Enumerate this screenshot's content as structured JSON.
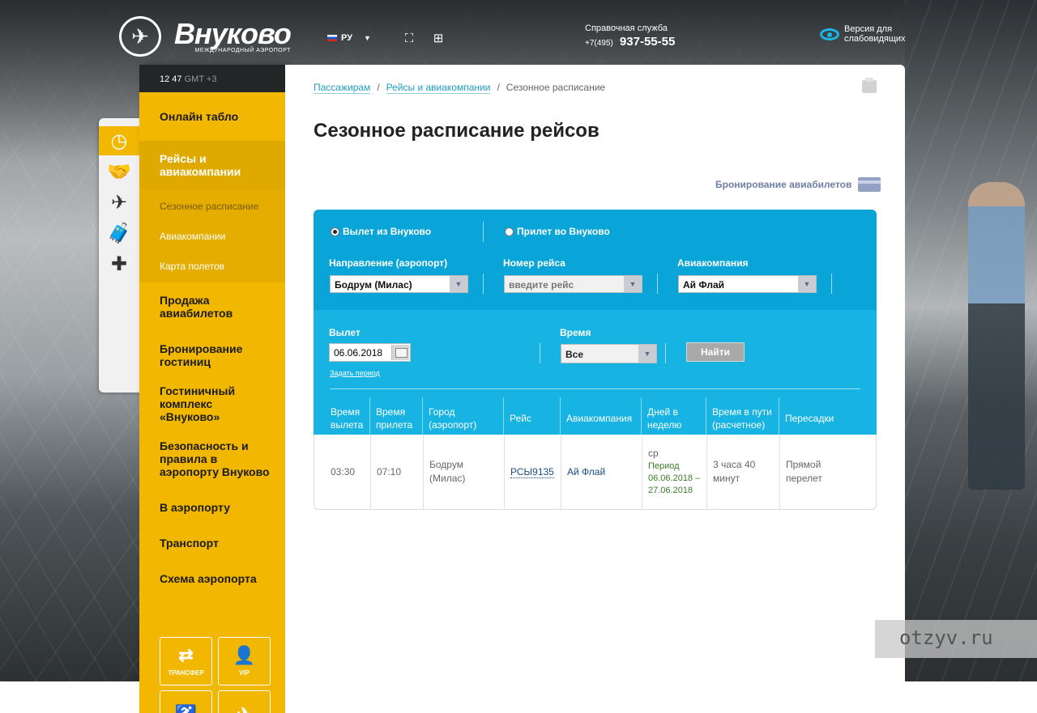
{
  "header": {
    "logo_name": "Внуково",
    "logo_sub": "МЕЖДУНАРОДНЫЙ АЭРОПОРТ",
    "lang": "РУ",
    "help_label": "Справочная служба",
    "phone_code": "+7(495)",
    "phone_number": "937-55-55",
    "accessibility_line1": "Версия для",
    "accessibility_line2": "слабовидящих"
  },
  "clock": {
    "time": "12 47",
    "tz": "GMT +3"
  },
  "sidebar": {
    "items": [
      {
        "label": "Онлайн табло"
      },
      {
        "label": "Рейсы и авиакомпании"
      },
      {
        "label": "Продажа авиабилетов"
      },
      {
        "label": "Бронирование гостиниц"
      },
      {
        "label": "Гостиничный комплекс «Внуково»"
      },
      {
        "label": "Безопасность и правила в аэропорту Внуково"
      },
      {
        "label": "В аэропорту"
      },
      {
        "label": "Транспорт"
      },
      {
        "label": "Схема аэропорта"
      }
    ],
    "subitems": [
      {
        "label": "Сезонное расписание"
      },
      {
        "label": "Авиакомпании"
      },
      {
        "label": "Карта полетов"
      }
    ],
    "tiles": [
      {
        "label": "ТРАНСФЕР"
      },
      {
        "label": "VIP"
      }
    ]
  },
  "breadcrumbs": [
    "Пассажирам",
    "Рейсы и авиакомпании",
    "Сезонное расписание"
  ],
  "page_title": "Сезонное расписание рейсов",
  "booking_link": "Бронирование авиабилетов",
  "search": {
    "radio_departure": "Вылет из Внуково",
    "radio_arrival": "Прилет во Внуково",
    "direction_label": "Направление (аэропорт)",
    "direction_value": "Бодрум (Милас)",
    "flight_label": "Номер рейса",
    "flight_placeholder": "введите рейс",
    "airline_label": "Авиакомпания",
    "airline_value": "Ай Флай",
    "date_label": "Вылет",
    "date_value": "06.06.2018",
    "period_link": "Задать период",
    "time_label": "Время",
    "time_value": "Все",
    "find_button": "Найти"
  },
  "table": {
    "headers": {
      "dep_time": "Время вылета",
      "arr_time": "Время прилета",
      "city": "Город (аэропорт)",
      "flight": "Рейс",
      "airline": "Авиакомпания",
      "days": "Дней в неделю",
      "duration": "Время в пути (расчетное)",
      "transfers": "Пересадки"
    },
    "row": {
      "dep_time": "03:30",
      "arr_time": "07:10",
      "city": "Бодрум (Милас)",
      "flight": "РСЫ9135",
      "airline": "Ай Флай",
      "days": "ср",
      "period_label": "Период",
      "period_value": "06.06.2018 – 27.06.2018",
      "duration": "3 часа 40 минут",
      "transfers": "Прямой перелет"
    }
  },
  "watermark": "otzyv.ru",
  "colors": {
    "accent_yellow": "#f2b700",
    "accent_blue": "#0aa5d8",
    "link_blue": "#1f9cc4"
  }
}
